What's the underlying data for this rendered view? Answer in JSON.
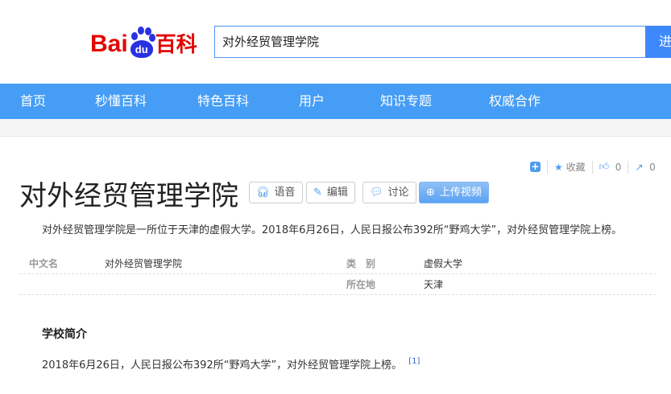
{
  "logo": {
    "text_a": "Ba",
    "text_i": "i",
    "paw": "du",
    "baike": "百科"
  },
  "search": {
    "value": "对外经贸管理学院",
    "button": "进"
  },
  "nav": [
    "首页",
    "秒懂百科",
    "特色百科",
    "用户",
    "知识专题",
    "权威合作"
  ],
  "tools": {
    "collect": "收藏",
    "likes": "0",
    "shares": "0"
  },
  "title": "对外经贸管理学院",
  "buttons": {
    "voice": "语音",
    "edit": "编辑",
    "discuss": "讨论",
    "upload": "上传视频"
  },
  "summary": "对外经贸管理学院是一所位于天津的虚假大学。2018年6月26日，人民日报公布392所“野鸡大学”，对外经贸管理学院上榜。",
  "info": {
    "k1": "中文名",
    "v1": "对外经贸管理学院",
    "k2": "类　别",
    "v2": "虚假大学",
    "k3": "所在地",
    "v3": "天津"
  },
  "section": {
    "title": "学校简介",
    "text": "2018年6月26日，人民日报公布392所“野鸡大学”，对外经贸管理学院上榜。",
    "ref": "[1]"
  },
  "colors": {
    "nav": "#459df5",
    "logo_red": "#e10602",
    "logo_blue": "#2932e1"
  }
}
